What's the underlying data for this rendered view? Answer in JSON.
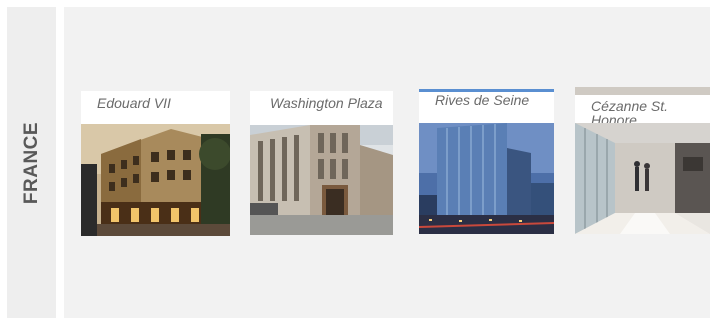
{
  "region": "FRANCE",
  "properties": [
    {
      "name": "Edouard VII"
    },
    {
      "name": "Washington Plaza"
    },
    {
      "name": "Rives de Seine"
    },
    {
      "name": "Cézanne St. Honore"
    }
  ]
}
